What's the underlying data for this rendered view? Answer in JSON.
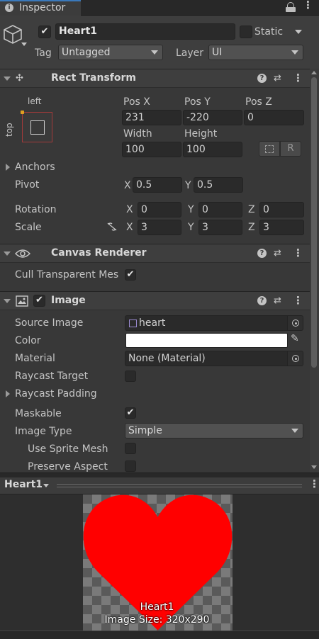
{
  "tab": {
    "title": "Inspector",
    "icon": "info-icon"
  },
  "gameobject": {
    "active": true,
    "name": "Heart1",
    "static_label": "Static",
    "tag_label": "Tag",
    "tag_value": "Untagged",
    "layer_label": "Layer",
    "layer_value": "UI"
  },
  "rect_transform": {
    "title": "Rect Transform",
    "anchor_h": "left",
    "anchor_v": "top",
    "posx_label": "Pos X",
    "posx": "231",
    "posy_label": "Pos Y",
    "posy": "-220",
    "posz_label": "Pos Z",
    "posz": "0",
    "width_label": "Width",
    "width": "100",
    "height_label": "Height",
    "height": "100",
    "raw_button": "R",
    "anchors_label": "Anchors",
    "pivot_label": "Pivot",
    "pivot_x_label": "X",
    "pivot_x": "0.5",
    "pivot_y_label": "Y",
    "pivot_y": "0.5",
    "rotation_label": "Rotation",
    "rot_x": "0",
    "rot_y": "0",
    "rot_z": "0",
    "scale_label": "Scale",
    "scale_x": "3",
    "scale_y": "3",
    "scale_z": "3",
    "x_label": "X",
    "y_label": "Y",
    "z_label": "Z"
  },
  "canvas_renderer": {
    "title": "Canvas Renderer",
    "cull_label": "Cull Transparent Mes",
    "cull_checked": true
  },
  "image": {
    "title": "Image",
    "enabled": true,
    "source_image_label": "Source Image",
    "source_image_value": "heart",
    "color_label": "Color",
    "color_value": "#ffffff",
    "material_label": "Material",
    "material_value": "None (Material)",
    "raycast_target_label": "Raycast Target",
    "raycast_target": false,
    "raycast_padding_label": "Raycast Padding",
    "maskable_label": "Maskable",
    "maskable": true,
    "image_type_label": "Image Type",
    "image_type_value": "Simple",
    "use_sprite_mesh_label": "Use Sprite Mesh",
    "use_sprite_mesh": false,
    "preserve_aspect_label": "Preserve Aspect",
    "preserve_aspect": false
  },
  "preview": {
    "title": "Heart1",
    "name": "Heart1",
    "size_text": "Image Size: 320x290",
    "heart_color": "#ff0000"
  }
}
